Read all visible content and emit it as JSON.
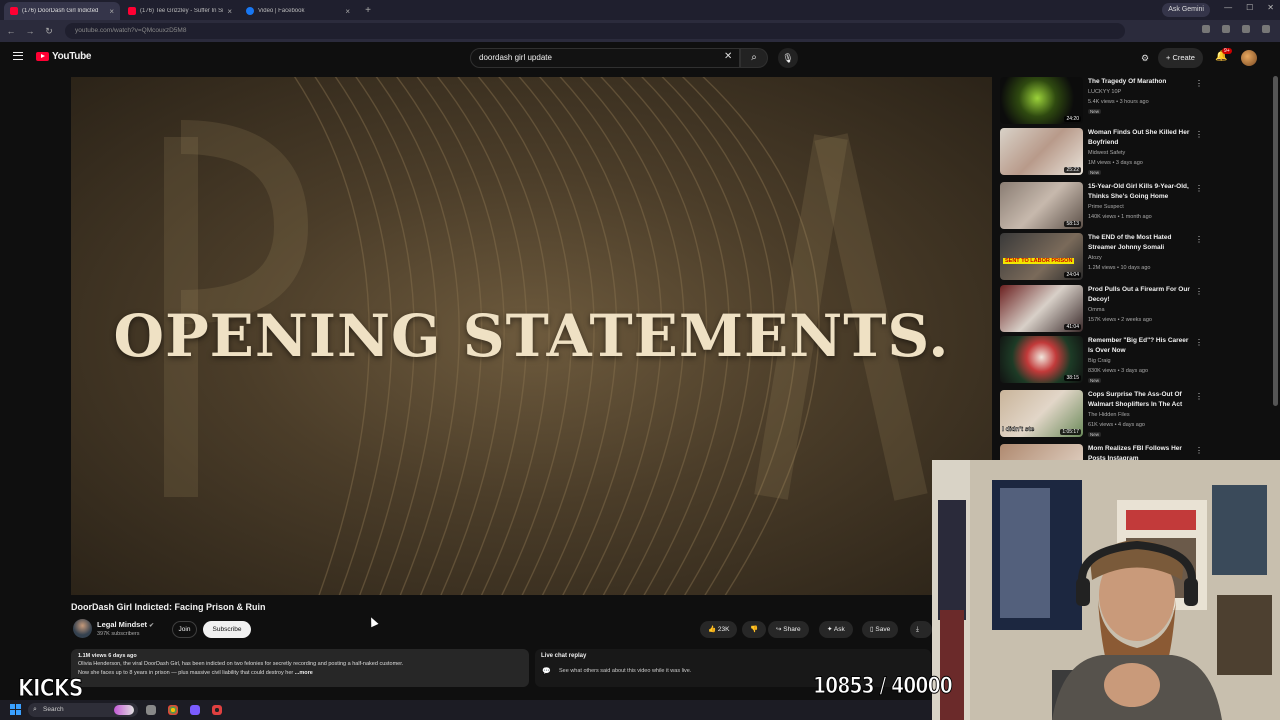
{
  "browser": {
    "tabs": [
      {
        "title": "(176) DoorDash Girl Indicted",
        "active": true,
        "kind": "youtube"
      },
      {
        "title": "(176) Tee Grizzley - Suffer In Silence",
        "active": false,
        "kind": "youtube"
      },
      {
        "title": "Video | Facebook",
        "active": false,
        "kind": "facebook"
      }
    ],
    "ask_gemini": "Ask Gemini",
    "address": "youtube.com/watch?v=QMcouxzD5M8"
  },
  "header": {
    "logo": "YouTube",
    "search_value": "doordash girl update",
    "create_label": "Create",
    "bell_badge": "9+"
  },
  "player": {
    "overlay_text": "OPENING STATEMENTS."
  },
  "video": {
    "title": "DoorDash Girl Indicted: Facing Prison & Ruin",
    "channel": "Legal Mindset",
    "subscribers": "397K subscribers",
    "join_label": "Join",
    "subscribe_label": "Subscribe",
    "likes": "23K",
    "share_label": "Share",
    "ask_label": "Ask",
    "save_label": "Save",
    "views_date": "1.1M views  6 days ago",
    "description_line1": "Olivia Henderson, the viral DoorDash Girl, has been indicted on two felonies for secretly recording and posting a half-naked customer.",
    "description_line2": "Now she faces up to 8 years in prison — plus massive civil liability that could destroy her",
    "more_label": "...more",
    "chat_replay_title": "Live chat replay",
    "chat_replay_text": "See what others said about this video while it was live."
  },
  "recommendations": [
    {
      "title": "The Tragedy Of Marathon",
      "channel": "LUCKYY 10P",
      "meta": "5.4K views • 3 hours ago",
      "badge": "New",
      "duration": "24:20"
    },
    {
      "title": "Woman Finds Out She Killed Her Boyfriend",
      "channel": "Midwest Safety",
      "meta": "1M views • 3 days ago",
      "badge": "New",
      "duration": "25:22"
    },
    {
      "title": "15-Year-Old Girl Kills 9-Year-Old, Thinks She's Going Home",
      "channel": "Prime Suspect",
      "meta": "140K views • 1 month ago",
      "badge": "",
      "duration": "58:13"
    },
    {
      "title": "The END of the Most Hated Streamer Johnny Somali",
      "channel": "Atozy",
      "meta": "1.2M views • 10 days ago",
      "badge": "",
      "duration": "24:04"
    },
    {
      "title": "Prod Pulls Out a Firearm For Our Decoy!",
      "channel": "Omma",
      "meta": "157K views • 2 weeks ago",
      "badge": "",
      "duration": "41:04"
    },
    {
      "title": "Remember \"Big Ed\"? His Career Is Over Now",
      "channel": "Big Craig",
      "meta": "830K views • 3 days ago",
      "badge": "New",
      "duration": "38:15"
    },
    {
      "title": "Cops Surprise The Ass-Out Of Walmart Shoplifters In The Act",
      "channel": "The Hidden Files",
      "meta": "61K views • 4 days ago",
      "badge": "New",
      "duration": "1:05:17"
    },
    {
      "title": "Mom Realizes FBI Follows Her Posts Instagram",
      "channel": "",
      "meta": "",
      "badge": "",
      "duration": ""
    }
  ],
  "rec_thumb_caption_3": "SENT TO LABOR PRISON",
  "rec_thumb_caption_6": "I didn't ste",
  "overlays": {
    "kicks": "KICKS",
    "counter": "10853 / 40000"
  },
  "taskbar": {
    "search_label": "Search"
  },
  "colors": {
    "yt_red": "#ff0033",
    "background": "#0f0f0f",
    "player_tint": "#5a4a32"
  }
}
